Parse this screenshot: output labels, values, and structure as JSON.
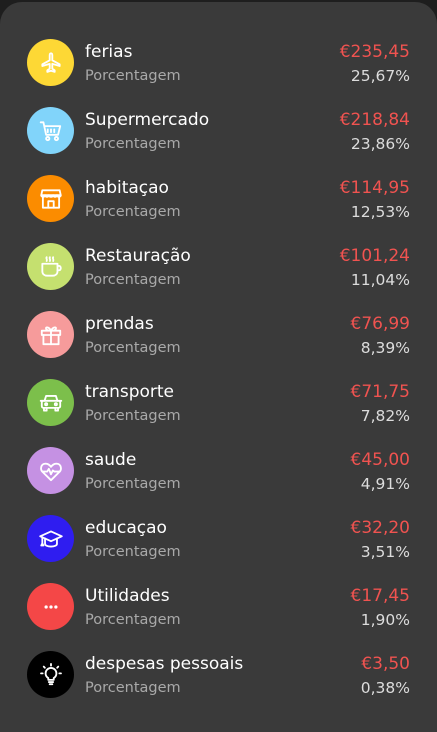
{
  "list": {
    "items": [
      {
        "name": "ferias",
        "subtitle": "Porcentagem",
        "amount": "€235,45",
        "percent": "25,67%",
        "color": "#fdd835",
        "icon": "airplane-icon"
      },
      {
        "name": "Supermercado",
        "subtitle": "Porcentagem",
        "amount": "€218,84",
        "percent": "23,86%",
        "color": "#81d4fa",
        "icon": "shopping-cart-icon"
      },
      {
        "name": "habitaçao",
        "subtitle": "Porcentagem",
        "amount": "€114,95",
        "percent": "12,53%",
        "color": "#fb8c00",
        "icon": "house-icon"
      },
      {
        "name": "Restauração",
        "subtitle": "Porcentagem",
        "amount": "€101,24",
        "percent": "11,04%",
        "color": "#c5e06f",
        "icon": "coffee-cup-icon"
      },
      {
        "name": "prendas",
        "subtitle": "Porcentagem",
        "amount": "€76,99",
        "percent": "8,39%",
        "color": "#f69b9b",
        "icon": "gift-icon"
      },
      {
        "name": "transporte",
        "subtitle": "Porcentagem",
        "amount": "€71,75",
        "percent": "7,82%",
        "color": "#7cbf4b",
        "icon": "car-icon"
      },
      {
        "name": "saude",
        "subtitle": "Porcentagem",
        "amount": "€45,00",
        "percent": "4,91%",
        "color": "#c591e3",
        "icon": "heart-pulse-icon"
      },
      {
        "name": "educaçao",
        "subtitle": "Porcentagem",
        "amount": "€32,20",
        "percent": "3,51%",
        "color": "#2f1df0",
        "icon": "graduation-cap-icon"
      },
      {
        "name": "Utilidades",
        "subtitle": "Porcentagem",
        "amount": "€17,45",
        "percent": "1,90%",
        "color": "#f44747",
        "icon": "more-dots-icon"
      },
      {
        "name": "despesas pessoais",
        "subtitle": "Porcentagem",
        "amount": "€3,50",
        "percent": "0,38%",
        "color": "#000000",
        "icon": "lightbulb-icon"
      }
    ]
  }
}
